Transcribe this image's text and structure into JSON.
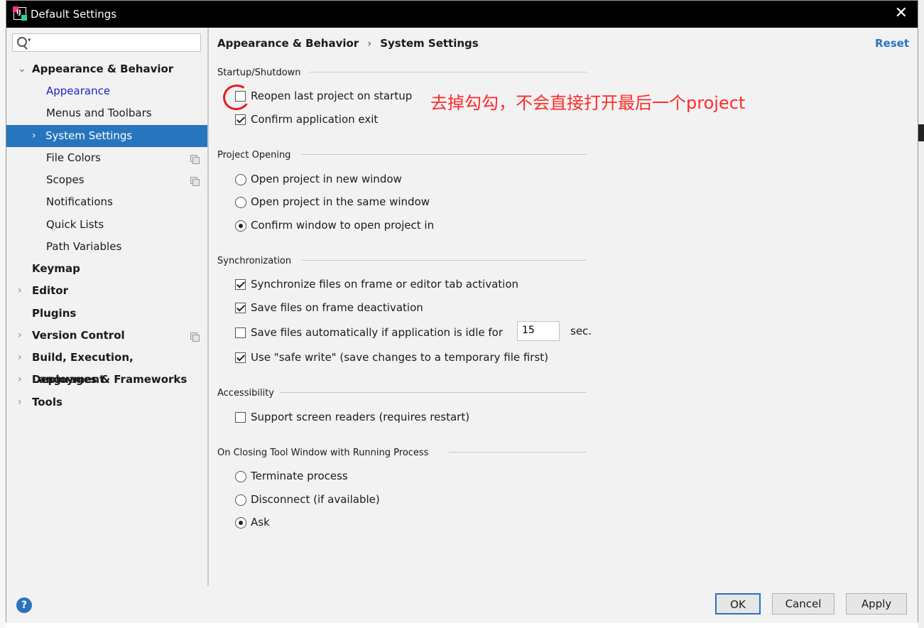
{
  "window": {
    "title": "Default Settings",
    "app_icon_text": "IJ",
    "close_icon": "close-icon"
  },
  "sidebar": {
    "search_placeholder": "",
    "items": [
      {
        "label": "Appearance & Behavior"
      },
      {
        "label": "Appearance"
      },
      {
        "label": "Menus and Toolbars"
      },
      {
        "label": "System Settings"
      },
      {
        "label": "File Colors"
      },
      {
        "label": "Scopes"
      },
      {
        "label": "Notifications"
      },
      {
        "label": "Quick Lists"
      },
      {
        "label": "Path Variables"
      },
      {
        "label": "Keymap"
      },
      {
        "label": "Editor"
      },
      {
        "label": "Plugins"
      },
      {
        "label": "Version Control"
      },
      {
        "label": "Build, Execution, Deployment"
      },
      {
        "label": "Languages & Frameworks"
      },
      {
        "label": "Tools"
      }
    ]
  },
  "breadcrumb": {
    "parent": "Appearance & Behavior",
    "separator": "›",
    "current": "System Settings"
  },
  "reset_label": "Reset",
  "sections": {
    "startup": {
      "title": "Startup/Shutdown",
      "reopen": "Reopen last project on startup",
      "confirm_exit": "Confirm application exit"
    },
    "project_opening": {
      "title": "Project Opening",
      "new_window": "Open project in new window",
      "same_window": "Open project in the same window",
      "confirm_window": "Confirm window to open project in"
    },
    "sync": {
      "title": "Synchronization",
      "sync_files": "Synchronize files on frame or editor tab activation",
      "save_deactivation": "Save files on frame deactivation",
      "save_idle": "Save files automatically if application is idle for",
      "idle_value": "15",
      "sec_label": "sec.",
      "safe_write": "Use \"safe write\" (save changes to a temporary file first)"
    },
    "accessibility": {
      "title": "Accessibility",
      "screen_readers": "Support screen readers (requires restart)"
    },
    "closing": {
      "title": "On Closing Tool Window with Running Process",
      "terminate": "Terminate process",
      "disconnect": "Disconnect (if available)",
      "ask": "Ask"
    }
  },
  "annotation": "去掉勾勾，不会直接打开最后一个project",
  "buttons": {
    "help": "?",
    "ok": "OK",
    "cancel": "Cancel",
    "apply": "Apply"
  },
  "colors": {
    "selection": "#2675bf",
    "link": "#2a72c0",
    "annotation": "#ff2a2a"
  }
}
